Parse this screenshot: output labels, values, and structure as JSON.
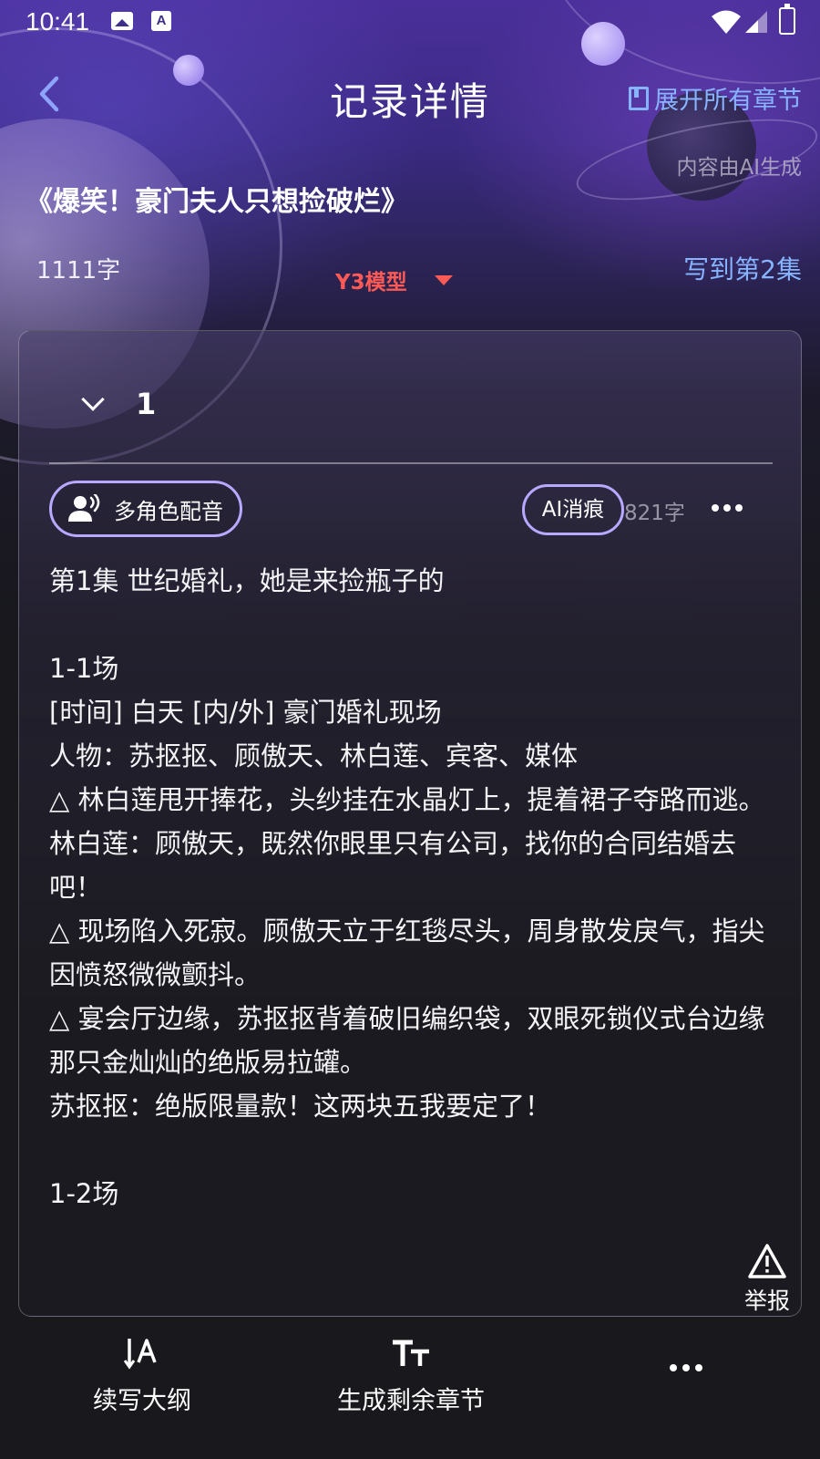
{
  "status_bar": {
    "time": "10:41",
    "a_icon_label": "A"
  },
  "header": {
    "title": "记录详情",
    "expand_all": "展开所有章节",
    "ai_note": "内容由AI生成"
  },
  "novel": {
    "title": "《爆笑！豪门夫人只想捡破烂》",
    "word_count": "1111字",
    "model": "Y3模型",
    "written_to": "写到第2集"
  },
  "chapter": {
    "number": "1",
    "voice_button": "多角色配音",
    "ai_trace_button": "AI消痕",
    "word_count": "821字",
    "lines": [
      "第1集 世纪婚礼，她是来捡瓶子的",
      "",
      "1-1场",
      "[时间] 白天 [内/外] 豪门婚礼现场",
      "人物：苏抠抠、顾傲天、林白莲、宾客、媒体",
      "△ 林白莲甩开捧花，头纱挂在水晶灯上，提着裙子夺路而逃。",
      "林白莲：顾傲天，既然你眼里只有公司，找你的合同结婚去吧！",
      "△ 现场陷入死寂。顾傲天立于红毯尽头，周身散发戾气，指尖因愤怒微微颤抖。",
      "△ 宴会厅边缘，苏抠抠背着破旧编织袋，双眼死锁仪式台边缘那只金灿灿的绝版易拉罐。",
      "苏抠抠：绝版限量款！这两块五我要定了！",
      "",
      "1-2场"
    ],
    "report_label": "举报"
  },
  "bottom_bar": {
    "continue_outline": "续写大纲",
    "generate_remaining": "生成剩余章节"
  },
  "icons": {
    "back": "back-icon",
    "expand": "book-icon",
    "voice": "voice-icon",
    "more": "more-icon",
    "report": "warning-icon",
    "continue": "text-cursor-icon",
    "generate": "text-size-icon"
  },
  "colors": {
    "accent_blue": "#86b4ff",
    "model_red": "#ff5a55",
    "button_border": "#b9a8ff"
  }
}
